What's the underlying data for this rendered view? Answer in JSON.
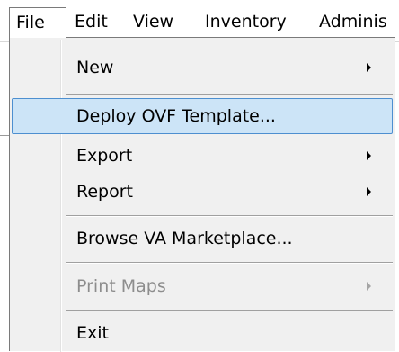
{
  "menubar": {
    "items": [
      {
        "label": "File"
      },
      {
        "label": "Edit"
      },
      {
        "label": "View"
      },
      {
        "label": "Inventory"
      },
      {
        "label": "Adminis"
      }
    ]
  },
  "file_menu": {
    "items": [
      {
        "label": "New",
        "has_submenu": true,
        "enabled": true
      },
      {
        "label": "Deploy OVF Template...",
        "has_submenu": false,
        "enabled": true,
        "highlighted": true
      },
      {
        "label": "Export",
        "has_submenu": true,
        "enabled": true
      },
      {
        "label": "Report",
        "has_submenu": true,
        "enabled": true
      },
      {
        "label": "Browse VA Marketplace...",
        "has_submenu": false,
        "enabled": true
      },
      {
        "label": "Print Maps",
        "has_submenu": true,
        "enabled": false
      },
      {
        "label": "Exit",
        "has_submenu": false,
        "enabled": true
      }
    ]
  },
  "colors": {
    "highlight_fill": "#cce4f7",
    "highlight_border": "#4d8fd0",
    "menu_background": "#f0f0f0",
    "disabled_text": "#8d8d8d"
  },
  "icons": {
    "submenu": "chevron-right-icon"
  }
}
